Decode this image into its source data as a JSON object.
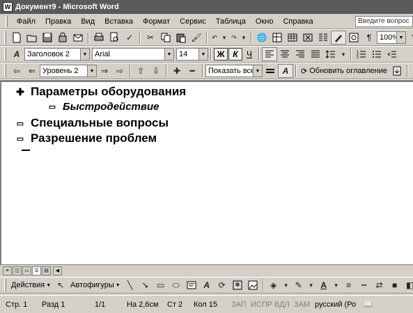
{
  "window": {
    "title": "Документ9 - Microsoft Word"
  },
  "menu": {
    "items": [
      "Файл",
      "Правка",
      "Вид",
      "Вставка",
      "Формат",
      "Сервис",
      "Таблица",
      "Окно",
      "Справка"
    ],
    "ask_placeholder": "Введите вопрос"
  },
  "standard_toolbar": {
    "zoom": "100%"
  },
  "formatting_toolbar": {
    "style": "Заголовок 2",
    "font": "Arial",
    "size": "14",
    "bold": "Ж",
    "italic": "К",
    "underline": "Ч"
  },
  "outlining_toolbar": {
    "level": "Уровень 2",
    "show_level": "Показать все",
    "update_toc": "Обновить оглавление"
  },
  "document": {
    "lines": [
      {
        "symbol": "plus",
        "level": 1,
        "text": "Параметры оборудования"
      },
      {
        "symbol": "minus",
        "level": 2,
        "text": "Быстродействие"
      },
      {
        "symbol": "minus",
        "level": 1,
        "text": "Специальные вопросы"
      },
      {
        "symbol": "minus",
        "level": 1,
        "text": "Разрешение проблем"
      }
    ]
  },
  "drawing_toolbar": {
    "actions": "Действия",
    "autoshapes": "Автофигуры"
  },
  "status": {
    "page": "Стр. 1",
    "section": "Разд 1",
    "pages": "1/1",
    "at": "На 2,6см",
    "line": "Ст 2",
    "col": "Кол 15",
    "rec": "ЗАП",
    "trk": "ИСПР",
    "ext": "ВДЛ",
    "ovr": "ЗАМ",
    "lang": "русский (Ро"
  }
}
